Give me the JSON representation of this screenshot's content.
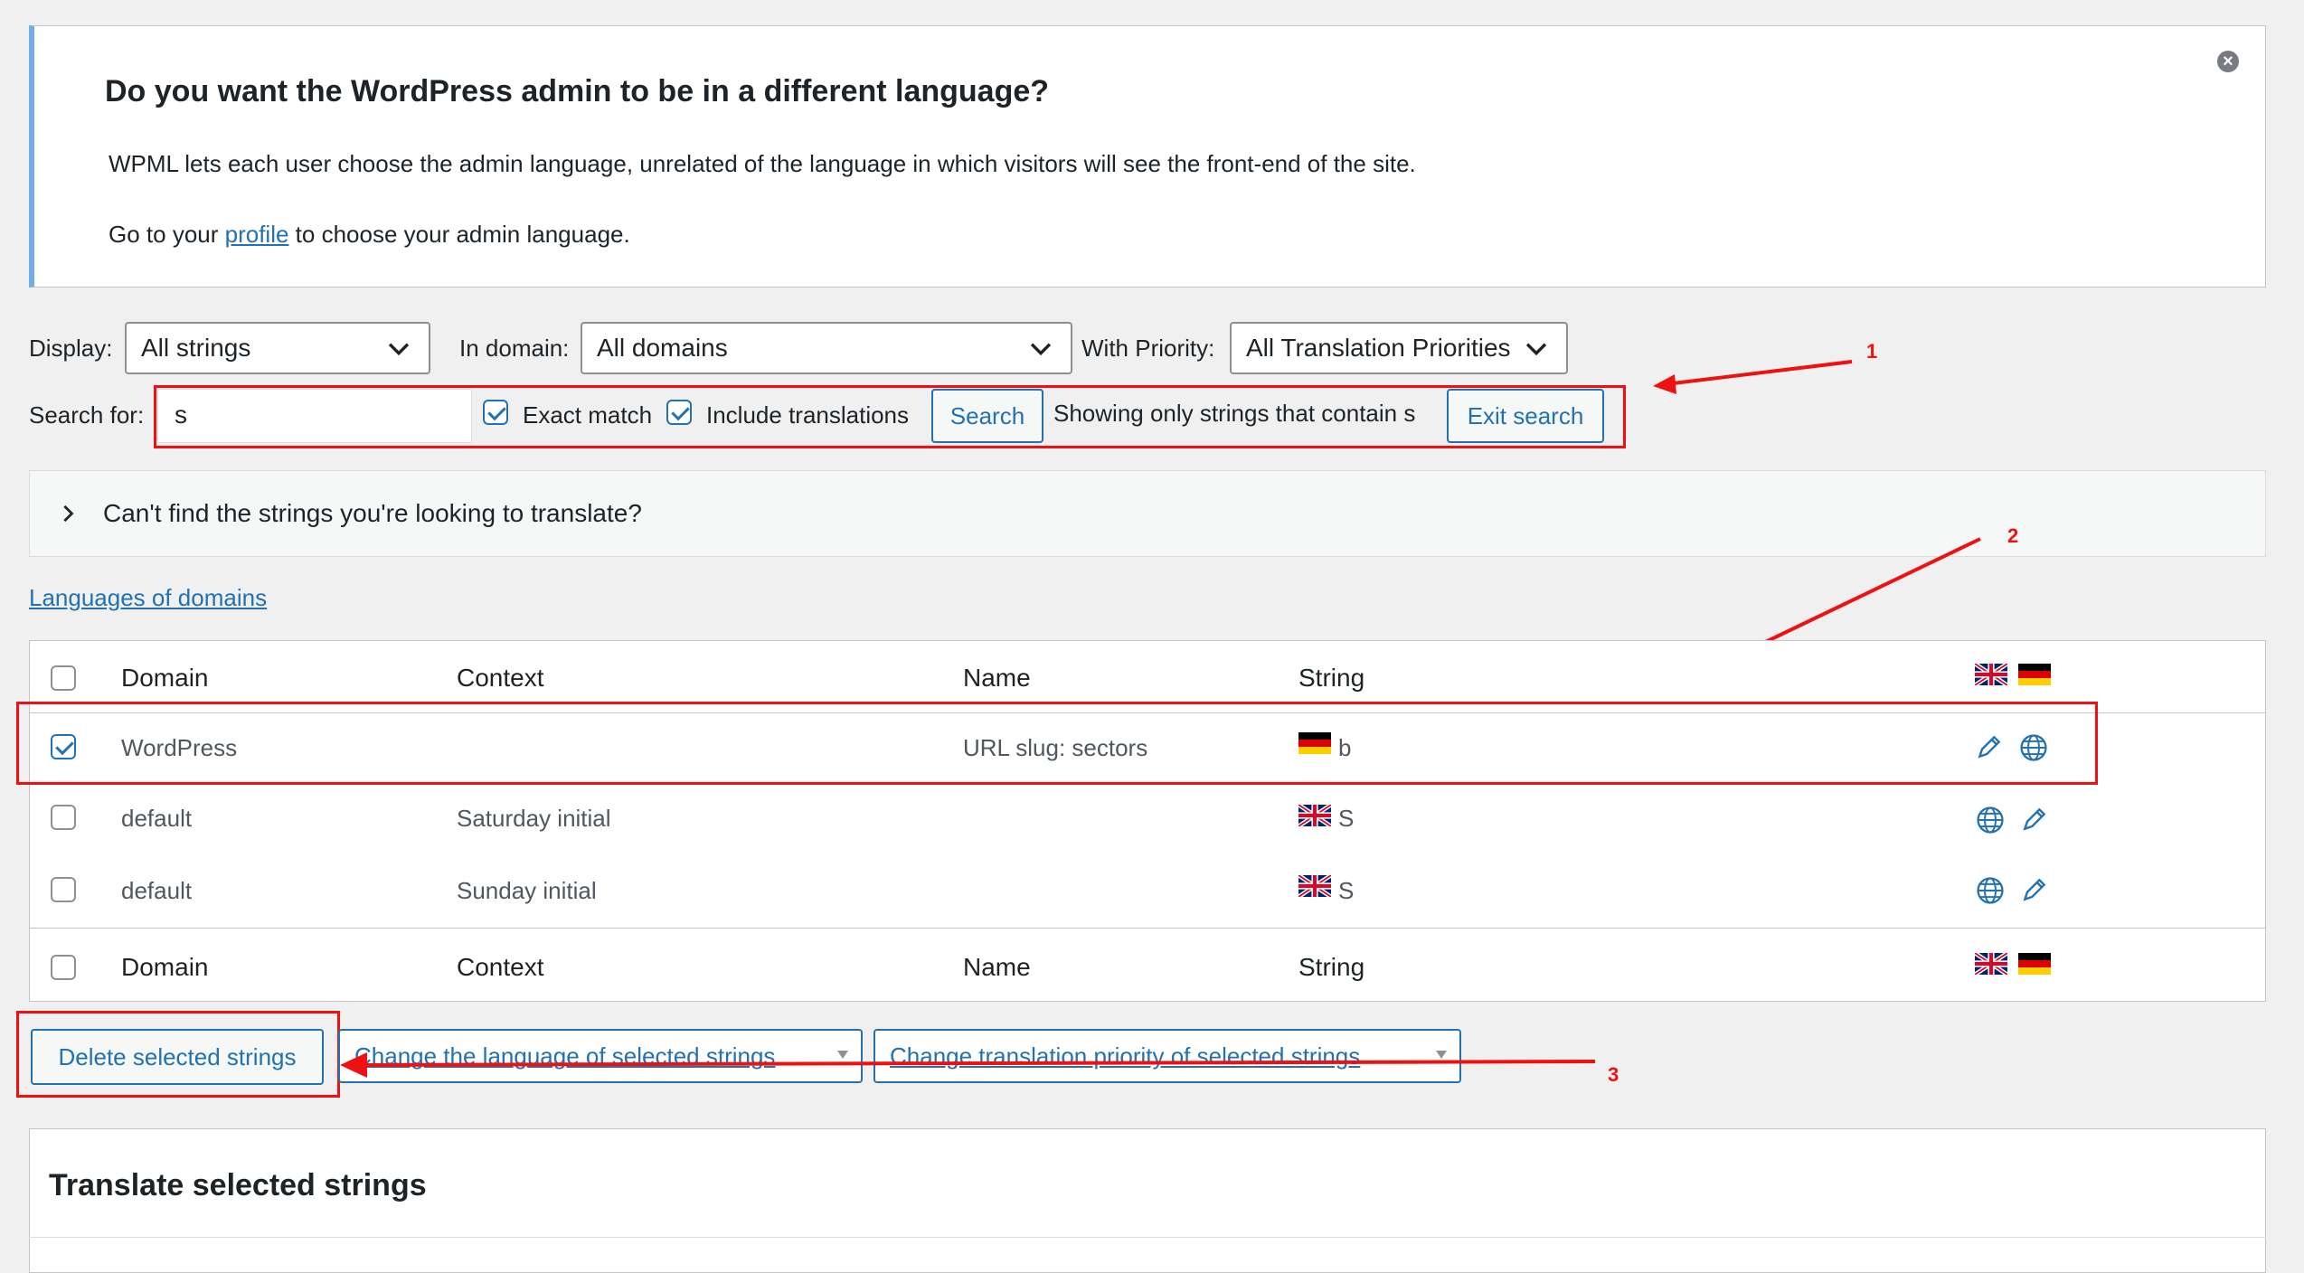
{
  "notice": {
    "title": "Do you want the WordPress admin to be in a different language?",
    "line1": "WPML lets each user choose the admin language, unrelated of the language in which visitors will see the front-end of the site.",
    "line2_prefix": "Go to your ",
    "line2_link": "profile",
    "line2_suffix": " to choose your admin language.",
    "dismiss_icon": "close-circle-icon"
  },
  "filters": {
    "display_label": "Display:",
    "display_value": "All strings",
    "domain_label": "In domain:",
    "domain_value": "All domains",
    "priority_label": "With Priority:",
    "priority_value": "All Translation Priorities"
  },
  "search": {
    "label": "Search for:",
    "value": "s",
    "exact_match_label": "Exact match",
    "exact_match_checked": true,
    "include_translations_label": "Include translations",
    "include_translations_checked": true,
    "search_button": "Search",
    "status_text": "Showing only strings that contain s",
    "exit_button": "Exit search"
  },
  "accordion": {
    "label": "Can't find the strings you're looking to translate?"
  },
  "languages_link": "Languages of domains",
  "table": {
    "columns": [
      "Domain",
      "Context",
      "Name",
      "String"
    ],
    "rows": [
      {
        "domain": "WordPress",
        "context": "",
        "name": "URL slug: sectors",
        "string": "b",
        "flag": "de",
        "checked": true
      },
      {
        "domain": "default",
        "context": "Saturday initial",
        "name": "",
        "string": "S",
        "flag": "uk",
        "checked": false
      },
      {
        "domain": "default",
        "context": "Sunday initial",
        "name": "",
        "string": "S",
        "flag": "uk",
        "checked": false
      }
    ]
  },
  "bulk": {
    "delete_button": "Delete selected strings",
    "change_language": "Change the language of selected strings",
    "change_priority": "Change translation priority of selected strings"
  },
  "translate_panel": {
    "title": "Translate selected strings"
  },
  "annotations": {
    "n1": "1",
    "n2": "2",
    "n3": "3"
  },
  "colors": {
    "accent": "#2271b1",
    "annotation": "#ee1111",
    "notice_border": "#72aee6"
  }
}
